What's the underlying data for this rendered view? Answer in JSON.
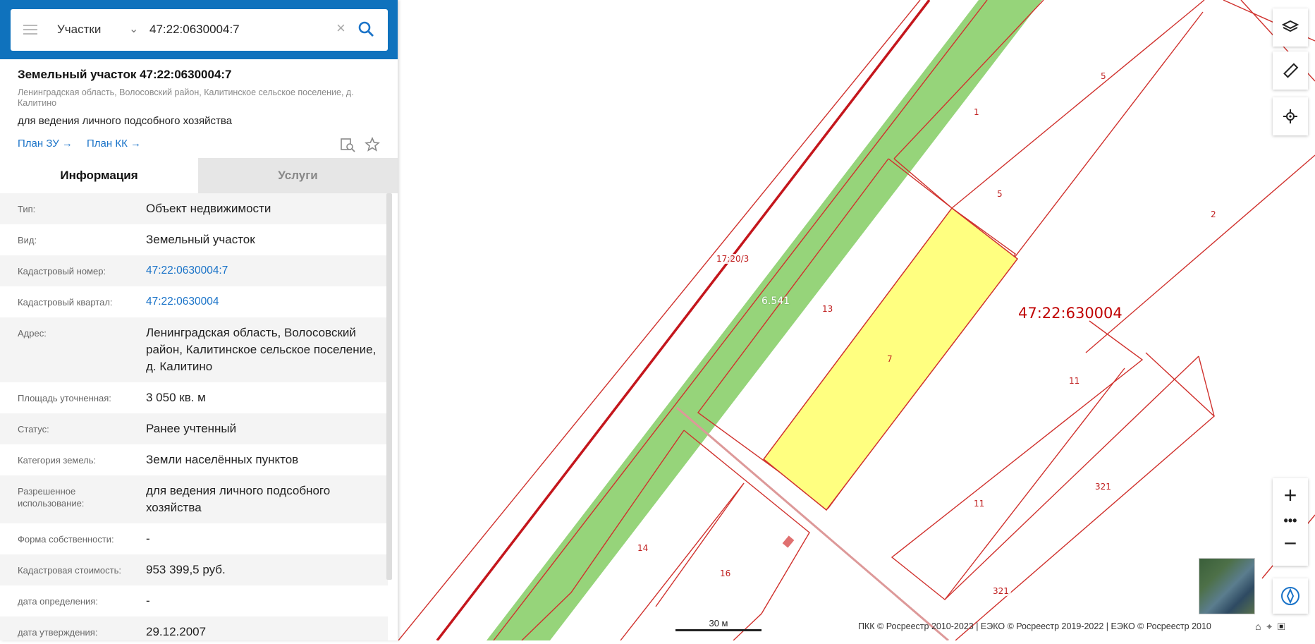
{
  "search": {
    "type_label": "Участки",
    "query": "47:22:0630004:7"
  },
  "card": {
    "title": "Земельный участок 47:22:0630004:7",
    "address": "Ленинградская область, Волосовский район, Калитинское сельское поселение, д. Калитино",
    "purpose": "для ведения личного подсобного хозяйства",
    "link_plan_zu": "План ЗУ",
    "link_plan_kk": "План КК"
  },
  "tabs": {
    "info": "Информация",
    "services": "Услуги"
  },
  "rows": [
    {
      "label": "Тип:",
      "value": "Объект недвижимости"
    },
    {
      "label": "Вид:",
      "value": "Земельный участок"
    },
    {
      "label": "Кадастровый номер:",
      "value": "47:22:0630004:7"
    },
    {
      "label": "Кадастровый квартал:",
      "value": "47:22:0630004"
    },
    {
      "label": "Адрес:",
      "value": "Ленинградская область, Волосовский район, Калитинское сельское поселение, д. Калитино"
    },
    {
      "label": "Площадь уточненная:",
      "value": "3 050 кв. м"
    },
    {
      "label": "Статус:",
      "value": "Ранее учтенный"
    },
    {
      "label": "Категория земель:",
      "value": "Земли населённых пунктов"
    },
    {
      "label": "Разрешенное использование:",
      "value": "для ведения личного подсобного хозяйства"
    },
    {
      "label": "Форма собственности:",
      "value": "-"
    },
    {
      "label": "Кадастровая стоимость:",
      "value": "953 399,5 руб."
    },
    {
      "label": "дата определения:",
      "value": "-"
    },
    {
      "label": "дата утверждения:",
      "value": "29.12.2007"
    }
  ],
  "map": {
    "quarter_label": "47:22:630004",
    "zone_label": "6.541",
    "zone_label_2": "17:20/3",
    "parcels": [
      "5",
      "1",
      "5",
      "2",
      "13",
      "7",
      "11",
      "11",
      "321",
      "321",
      "14",
      "16"
    ],
    "scale_label": "30 м",
    "attribution": "ПКК © Росреестр 2010-2023 | ЕЭКО © Росреестр 2019-2022 | ЕЭКО © Росреестр 2010"
  },
  "colors": {
    "header_blue": "#0f72bd",
    "link_blue": "#1a73c8",
    "parcel_outline": "#d0312d",
    "selected_fill": "#ffff80",
    "zone_green": "#96d47a"
  }
}
